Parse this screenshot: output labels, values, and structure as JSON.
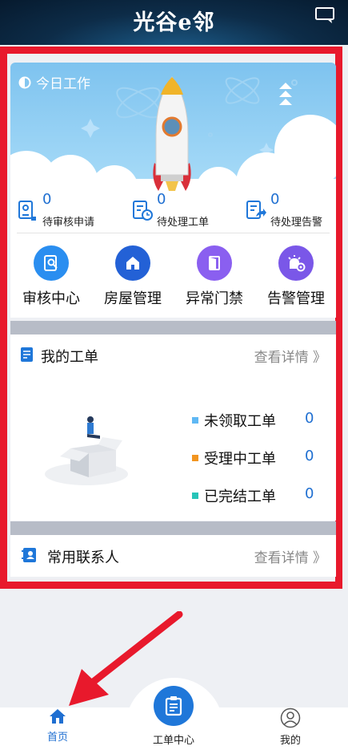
{
  "header": {
    "title": "光谷e邻",
    "message_icon": "message-icon"
  },
  "today": {
    "title": "今日工作",
    "stats": [
      {
        "count": "0",
        "label": "待审核申请",
        "icon": "audit-doc-icon"
      },
      {
        "count": "0",
        "label": "待处理工单",
        "icon": "clock-doc-icon"
      },
      {
        "count": "0",
        "label": "待处理告警",
        "icon": "share-doc-icon"
      }
    ],
    "quick": [
      {
        "label": "审核中心",
        "icon": "search-doc-icon",
        "color": "#2a8ef0"
      },
      {
        "label": "房屋管理",
        "icon": "house-icon",
        "color": "#2361d6"
      },
      {
        "label": "异常门禁",
        "icon": "door-icon",
        "color": "#8a5ff0"
      },
      {
        "label": "告警管理",
        "icon": "alarm-gear-icon",
        "color": "#7a57e8"
      }
    ]
  },
  "orders": {
    "title": "我的工单",
    "more": "查看详情 》",
    "items": [
      {
        "label": "未领取工单",
        "value": "0",
        "color": "#5fb8f4"
      },
      {
        "label": "受理中工单",
        "value": "0",
        "color": "#f2951f"
      },
      {
        "label": "已完结工单",
        "value": "0",
        "color": "#27c4b8"
      }
    ]
  },
  "contacts": {
    "title": "常用联系人",
    "more": "查看详情 》"
  },
  "nav": {
    "home": "首页",
    "workorder": "工单中心",
    "mine": "我的"
  },
  "colors": {
    "accent": "#1f6fd1",
    "highlight": "#e8192c"
  }
}
